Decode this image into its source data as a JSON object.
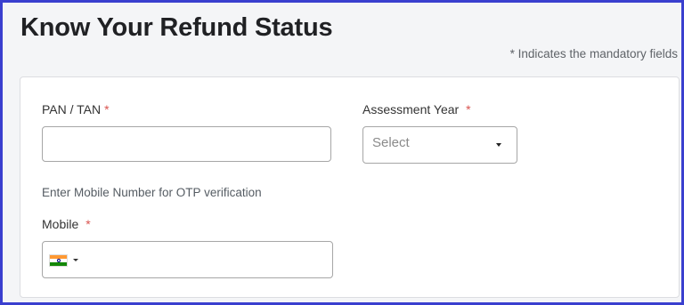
{
  "page": {
    "title": "Know Your Refund Status",
    "mandatory_note_star": "*",
    "mandatory_note_text": "Indicates the mandatory fields"
  },
  "form": {
    "pan_tan": {
      "label": "PAN / TAN",
      "required_marker": "*",
      "value": ""
    },
    "assessment_year": {
      "label": "Assessment Year",
      "required_marker": "*",
      "placeholder": "Select",
      "selected_value": ""
    },
    "otp_hint": "Enter Mobile Number for OTP verification",
    "mobile": {
      "label": "Mobile",
      "required_marker": "*",
      "country_flag": "india-flag-icon",
      "value": ""
    }
  },
  "colors": {
    "frame_border": "#3a3fcf",
    "background": "#f4f5f7",
    "required_marker": "#d9534f"
  }
}
